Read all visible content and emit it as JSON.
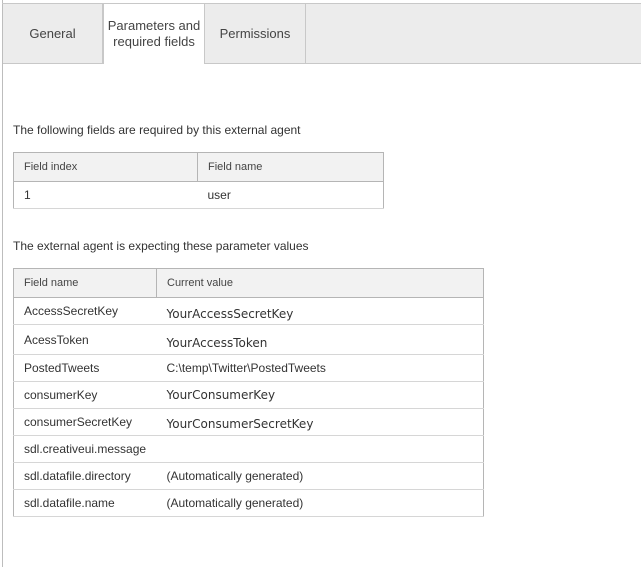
{
  "tabs": [
    {
      "label": "General"
    },
    {
      "label_line1": "Parameters and",
      "label_line2": "required fields"
    },
    {
      "label": "Permissions"
    }
  ],
  "required_section": {
    "title": "The following fields are required by this external agent",
    "columns": [
      "Field index",
      "Field name"
    ],
    "rows": [
      {
        "index": "1",
        "name": "user"
      }
    ]
  },
  "parameter_section": {
    "title": "The external agent is expecting these parameter values",
    "columns": [
      "Field name",
      "Current value"
    ],
    "rows": [
      {
        "name": "AccessSecretKey",
        "value": "YourAccessSecretKey"
      },
      {
        "name": "AcessToken",
        "value": "YourAccessToken"
      },
      {
        "name": "PostedTweets",
        "value": "C:\\temp\\Twitter\\PostedTweets"
      },
      {
        "name": "consumerKey",
        "value": "YourConsumerKey"
      },
      {
        "name": "consumerSecretKey",
        "value": "YourConsumerSecretKey"
      },
      {
        "name": "sdl.creativeui.message",
        "value": ""
      },
      {
        "name": "sdl.datafile.directory",
        "value": "(Automatically generated)"
      },
      {
        "name": "sdl.datafile.name",
        "value": "(Automatically generated)"
      }
    ]
  }
}
